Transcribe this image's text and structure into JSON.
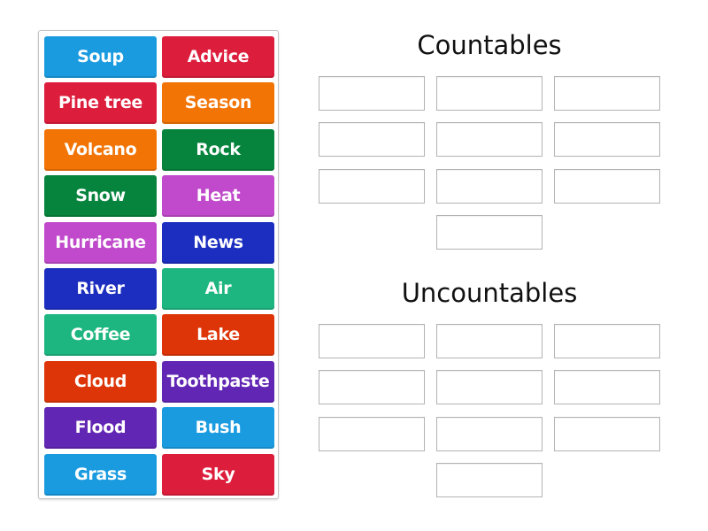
{
  "activity": "group-sort",
  "tiles": [
    {
      "label": "Soup",
      "color": "#1a9be0"
    },
    {
      "label": "Advice",
      "color": "#dd1d3c"
    },
    {
      "label": "Pine tree",
      "color": "#dd1d3c"
    },
    {
      "label": "Season",
      "color": "#f27405"
    },
    {
      "label": "Volcano",
      "color": "#f27405"
    },
    {
      "label": "Rock",
      "color": "#06843d"
    },
    {
      "label": "Snow",
      "color": "#06843d"
    },
    {
      "label": "Heat",
      "color": "#c04acb"
    },
    {
      "label": "Hurricane",
      "color": "#c04acb"
    },
    {
      "label": "News",
      "color": "#1c2ec0"
    },
    {
      "label": "River",
      "color": "#1c2ec0"
    },
    {
      "label": "Air",
      "color": "#1db680"
    },
    {
      "label": "Coffee",
      "color": "#1db680"
    },
    {
      "label": "Lake",
      "color": "#dd3507"
    },
    {
      "label": "Cloud",
      "color": "#dd3507"
    },
    {
      "label": "Toothpaste",
      "color": "#6226b4"
    },
    {
      "label": "Flood",
      "color": "#6226b4"
    },
    {
      "label": "Bush",
      "color": "#1a9be0"
    },
    {
      "label": "Grass",
      "color": "#1a9be0"
    },
    {
      "label": "Sky",
      "color": "#dd1d3c"
    }
  ],
  "groups": [
    {
      "title": "Countables",
      "slot_count": 10
    },
    {
      "title": "Uncountables",
      "slot_count": 10
    }
  ]
}
